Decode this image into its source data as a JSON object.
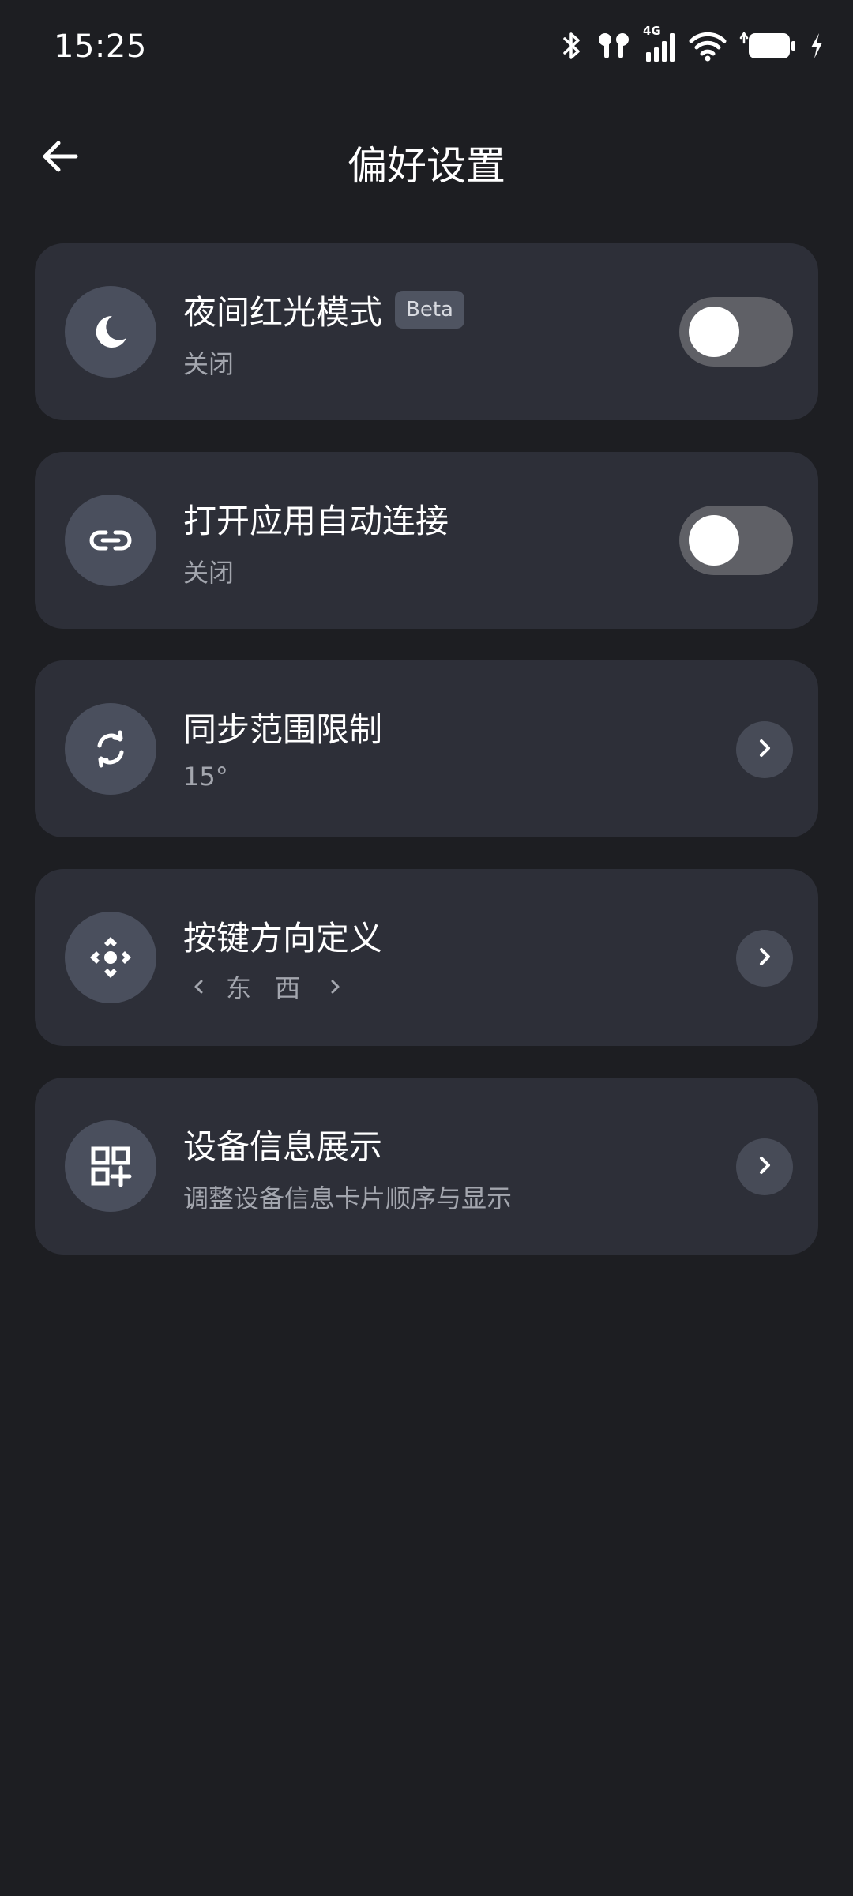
{
  "status_bar": {
    "time": "15:25",
    "network_label": "4G"
  },
  "header": {
    "title": "偏好设置"
  },
  "settings": [
    {
      "title": "夜间红光模式",
      "badge": "Beta",
      "subtitle": "关闭",
      "icon": "moon-icon",
      "control": "toggle",
      "enabled": false
    },
    {
      "title": "打开应用自动连接",
      "subtitle": "关闭",
      "icon": "link-icon",
      "control": "toggle",
      "enabled": false
    },
    {
      "title": "同步范围限制",
      "subtitle": "15°",
      "icon": "sync-icon",
      "control": "chevron"
    },
    {
      "title": "按键方向定义",
      "subtitle": "东 西",
      "icon": "direction-pad-icon",
      "control": "chevron"
    },
    {
      "title": "设备信息展示",
      "subtitle": "调整设备信息卡片顺序与显示",
      "icon": "grid-add-icon",
      "control": "chevron"
    }
  ],
  "colors": {
    "background": "#1d1e22",
    "card": "#2d2f38",
    "icon_circle": "#4a4f5d",
    "toggle_off": "#5f6066",
    "subtitle": "#a3a6ae"
  }
}
